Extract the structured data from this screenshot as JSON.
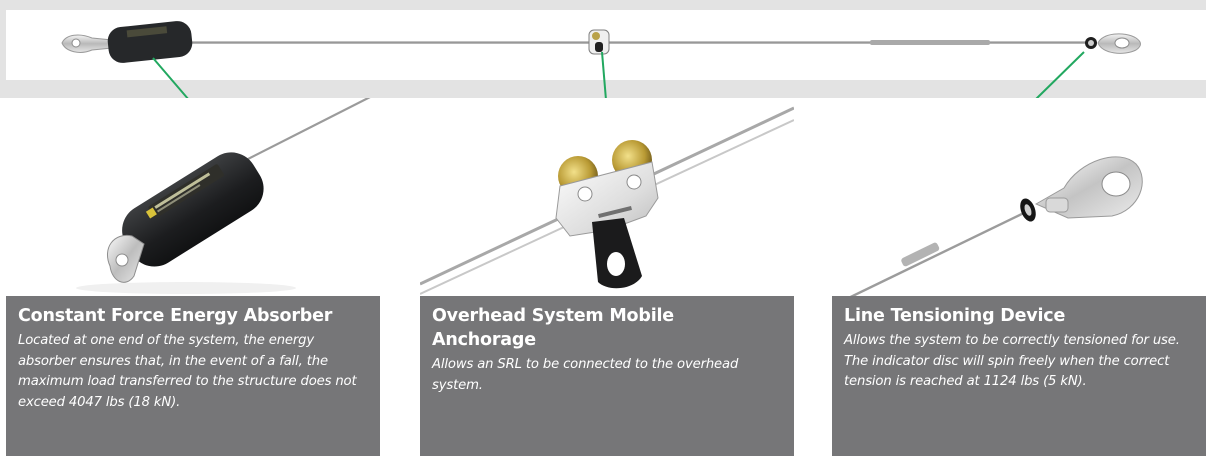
{
  "cards": [
    {
      "title": "Constant Force Energy Absorber",
      "description": "Located at one end of the system, the energy absorber ensures that, in the event of a fall, the maximum load transferred to the structure does not exceed 4047 lbs (18 kN)."
    },
    {
      "title": "Overhead System Mobile Anchorage",
      "description": "Allows an SRL to be connected to the overhead system."
    },
    {
      "title": "Line Tensioning Device",
      "description": "Allows the system to be correctly tensioned for use. The indicator disc will spin freely when the correct tension is reached at 1124  lbs (5 kN)."
    }
  ],
  "colors": {
    "caption_background": "#767678",
    "leader_line": "#22a860",
    "top_band": "#e3e3e3"
  }
}
